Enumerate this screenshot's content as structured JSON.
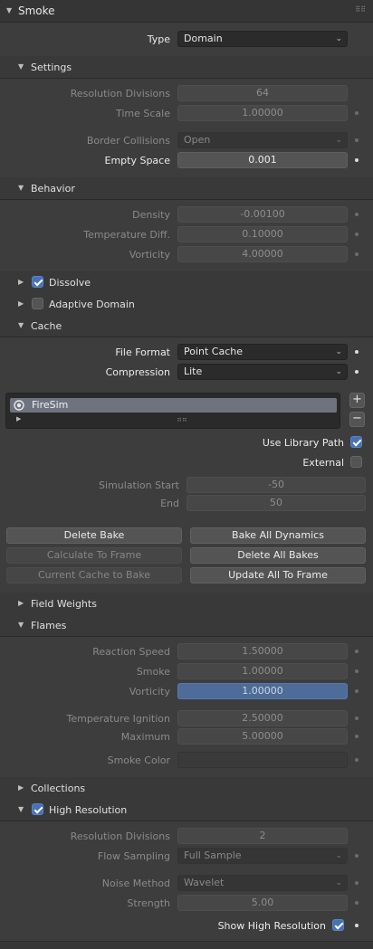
{
  "panel": {
    "title": "Smoke"
  },
  "type": {
    "label": "Type",
    "value": "Domain"
  },
  "settings": {
    "title": "Settings",
    "resolution_divisions": {
      "label": "Resolution Divisions",
      "value": "64"
    },
    "time_scale": {
      "label": "Time Scale",
      "value": "1.00000"
    },
    "border_collisions": {
      "label": "Border Collisions",
      "value": "Open"
    },
    "empty_space": {
      "label": "Empty Space",
      "value": "0.001"
    }
  },
  "behavior": {
    "title": "Behavior",
    "density": {
      "label": "Density",
      "value": "-0.00100"
    },
    "temperature_diff": {
      "label": "Temperature Diff.",
      "value": "0.10000"
    },
    "vorticity": {
      "label": "Vorticity",
      "value": "4.00000"
    }
  },
  "dissolve": {
    "label": "Dissolve",
    "checked": true
  },
  "adaptive_domain": {
    "label": "Adaptive Domain",
    "checked": false
  },
  "cache": {
    "title": "Cache",
    "file_format": {
      "label": "File Format",
      "value": "Point Cache"
    },
    "compression": {
      "label": "Compression",
      "value": "Lite"
    },
    "list_items": [
      "FireSim"
    ],
    "add_symbol": "+",
    "remove_symbol": "−",
    "use_library_path": {
      "label": "Use Library Path",
      "checked": true
    },
    "external": {
      "label": "External",
      "checked": false
    },
    "simulation_start": {
      "label": "Simulation Start",
      "value": "-50"
    },
    "end": {
      "label": "End",
      "value": "50"
    },
    "buttons": {
      "delete_bake": "Delete Bake",
      "bake_all_dynamics": "Bake All Dynamics",
      "calculate_to_frame": "Calculate To Frame",
      "delete_all_bakes": "Delete All Bakes",
      "current_cache_to_bake": "Current Cache to Bake",
      "update_all_to_frame": "Update All To Frame"
    }
  },
  "field_weights": {
    "title": "Field Weights"
  },
  "flames": {
    "title": "Flames",
    "reaction_speed": {
      "label": "Reaction Speed",
      "value": "1.50000"
    },
    "smoke": {
      "label": "Smoke",
      "value": "1.00000"
    },
    "vorticity": {
      "label": "Vorticity",
      "value": "1.00000"
    },
    "temperature_ignition": {
      "label": "Temperature Ignition",
      "value": "2.50000"
    },
    "maximum": {
      "label": "Maximum",
      "value": "5.00000"
    },
    "smoke_color": {
      "label": "Smoke Color"
    }
  },
  "collections": {
    "title": "Collections"
  },
  "high_resolution": {
    "title": "High Resolution",
    "checked": true,
    "resolution_divisions": {
      "label": "Resolution Divisions",
      "value": "2"
    },
    "flow_sampling": {
      "label": "Flow Sampling",
      "value": "Full Sample"
    },
    "noise_method": {
      "label": "Noise Method",
      "value": "Wavelet"
    },
    "strength": {
      "label": "Strength",
      "value": "5.00"
    },
    "show_high_resolution": {
      "label": "Show High Resolution",
      "checked": true
    }
  },
  "icons": [
    "panel-collapse-icon",
    "chevron-down-icon",
    "radio-icon",
    "drag-grip-icon"
  ],
  "colors": {
    "background": "#3d3d3d",
    "accent": "#4772b3",
    "highlight_field": "#4d6c9a"
  }
}
